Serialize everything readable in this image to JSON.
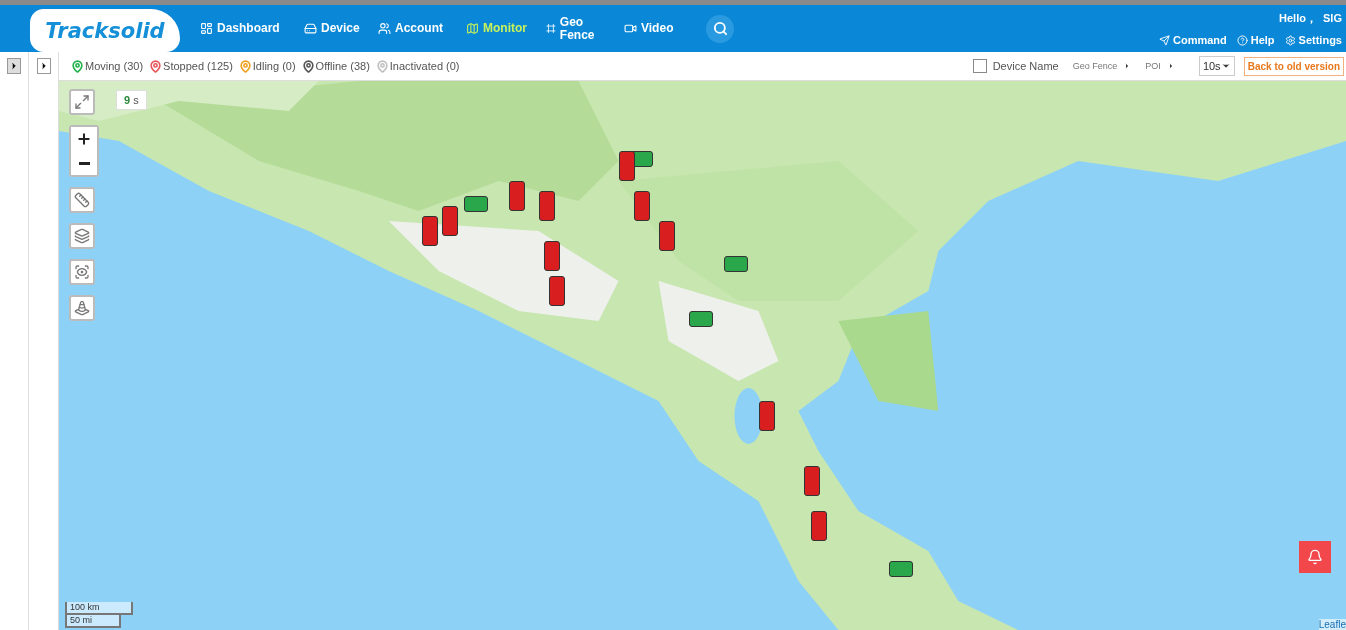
{
  "header": {
    "logo": "Tracksolid",
    "nav": [
      {
        "label": "Dashboard",
        "selected": false
      },
      {
        "label": "Device",
        "selected": false
      },
      {
        "label": "Account",
        "selected": false
      },
      {
        "label": "Monitor",
        "selected": true
      },
      {
        "label": "Geo Fence",
        "selected": false
      },
      {
        "label": "Video",
        "selected": false
      }
    ],
    "greeting": "Hello，  SIG",
    "links": [
      "Command",
      "Help",
      "Settings"
    ]
  },
  "toolbar": {
    "statuses": [
      {
        "label": "Moving (30)",
        "color": "#22b14c"
      },
      {
        "label": "Stopped (125)",
        "color": "#e8575a"
      },
      {
        "label": "Idling (0)",
        "color": "#f0a020"
      },
      {
        "label": "Offline (38)",
        "color": "#555555"
      },
      {
        "label": "Inactivated (0)",
        "color": "#c0c0c0"
      }
    ],
    "device_name": {
      "label": "Device Name",
      "checked": false
    },
    "menus": [
      "Geo Fence",
      "POI"
    ],
    "interval": "10s",
    "back_button": "Back to old version"
  },
  "map": {
    "countdown": "9",
    "countdown_unit": "s",
    "scale": [
      "100 km",
      "50 mi"
    ],
    "attribution": "Leafle",
    "markers": [
      {
        "kind": "stopped"
      },
      {
        "kind": "stopped"
      },
      {
        "kind": "moving"
      },
      {
        "kind": "stopped"
      },
      {
        "kind": "stopped"
      },
      {
        "kind": "moving"
      },
      {
        "kind": "stopped"
      },
      {
        "kind": "stopped"
      },
      {
        "kind": "moving"
      },
      {
        "kind": "stopped"
      },
      {
        "kind": "stopped"
      },
      {
        "kind": "moving"
      },
      {
        "kind": "stopped"
      },
      {
        "kind": "stopped"
      },
      {
        "kind": "stopped"
      },
      {
        "kind": "moving"
      },
      {
        "kind": "stopped"
      }
    ]
  }
}
